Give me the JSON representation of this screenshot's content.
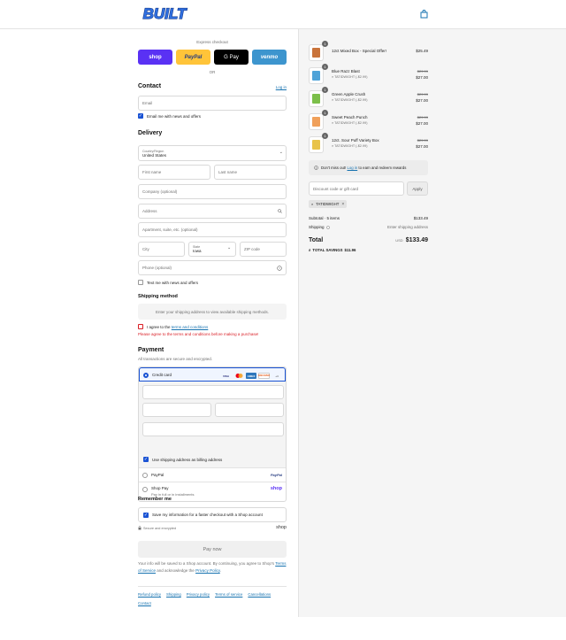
{
  "header": {
    "brand": "BUILT",
    "brand_color": "#2f6fe0"
  },
  "express": {
    "title": "Express checkout",
    "buttons": [
      {
        "label": "shop",
        "bg": "#5a31f4",
        "color": "#ffffff"
      },
      {
        "label": "PayPal",
        "bg": "#ffc439",
        "color": "#253b80"
      },
      {
        "label": "G Pay",
        "bg": "#000000",
        "color": "#ffffff"
      },
      {
        "label": "venmo",
        "bg": "#3d95ce",
        "color": "#ffffff"
      }
    ],
    "or": "OR"
  },
  "contact": {
    "heading": "Contact",
    "login": "Log in",
    "email_placeholder": "Email",
    "news_label": "Email me with news and offers"
  },
  "delivery": {
    "heading": "Delivery",
    "country_label": "Country/Region",
    "country_value": "United States",
    "first_name": "First name",
    "last_name": "Last name",
    "company": "Company (optional)",
    "address": "Address",
    "apartment": "Apartment, suite, etc. (optional)",
    "city": "City",
    "state_label": "State",
    "state_value": "Iowa",
    "zip": "ZIP code",
    "phone": "Phone (optional)",
    "text_label": "Text me with news and offers"
  },
  "shipping": {
    "heading": "Shipping method",
    "notice": "Enter your shipping address to view available shipping methods.",
    "agree_prefix": "I agree to the ",
    "agree_link": "terms and conditions",
    "error": "Please agree to the terms and conditions before making a purchase!"
  },
  "payment": {
    "heading": "Payment",
    "subtitle": "All transactions are secure and encrypted.",
    "credit_card": "Credit card",
    "card_brands": [
      "VISA",
      "MC",
      "AMEX",
      "DISCOVER",
      "+4"
    ],
    "billing_label": "Use shipping address as billing address",
    "paypal": "PayPal",
    "paypal_logo": "PayPal",
    "shop_pay": "Shop Pay",
    "shop_pay_sub": "Pay in full or in installments",
    "shop_logo": "shop"
  },
  "remember": {
    "heading": "Remember me",
    "label": "Save my information for a faster checkout with a Shop account",
    "secure": "Secure and encrypted",
    "shop_logo": "shop"
  },
  "pay_now": "Pay now",
  "legal": {
    "text1": "Your info will be saved to a Shop account. By continuing, you agree to Shop's",
    "tos": "Terms of Service",
    "text2": " and acknowledge the ",
    "privacy": "Privacy Policy",
    "end": "."
  },
  "footer_links": [
    "Refund policy",
    "Shipping",
    "Privacy policy",
    "Terms of service",
    "Cancellations",
    "Contact"
  ],
  "summary": {
    "items": [
      {
        "qty": "1",
        "title": "12ct Mixed Box - Special Offer!",
        "discount": "",
        "old": "",
        "price": "$25.49",
        "img": "#c9733a"
      },
      {
        "qty": "1",
        "title": "Blue Razz Blast",
        "discount": "TATIDWIGHT (-$2.99)",
        "old": "$29.99",
        "price": "$27.00",
        "img": "#4fa3d8"
      },
      {
        "qty": "1",
        "title": "Green Apple Crush",
        "discount": "TATIDWIGHT (-$2.99)",
        "old": "$29.99",
        "price": "$27.00",
        "img": "#7cbf4a"
      },
      {
        "qty": "1",
        "title": "Sweet Peach Punch",
        "discount": "TATIDWIGHT (-$2.99)",
        "old": "$29.99",
        "price": "$27.00",
        "img": "#f0a05a"
      },
      {
        "qty": "1",
        "title": "12ct. Sour Puff Variety Box",
        "discount": "TATIDWIGHT (-$2.99)",
        "old": "$29.99",
        "price": "$27.00",
        "img": "#e8c34a"
      }
    ],
    "rewards_prefix": "Don't miss out! ",
    "rewards_link": "Log in",
    "rewards_suffix": " to earn and redeem rewards",
    "discount_placeholder": "Discount code or gift card",
    "apply": "Apply",
    "code_chip": "TATIDWIGHT",
    "subtotal_label": "Subtotal · 5 items",
    "subtotal_value": "$133.49",
    "shipping_label": "Shipping",
    "shipping_value": "Enter shipping address",
    "total_label": "Total",
    "currency": "USD",
    "total_value": "$133.49",
    "savings_label": "TOTAL SAVINGS",
    "savings_value": "$11.96"
  }
}
